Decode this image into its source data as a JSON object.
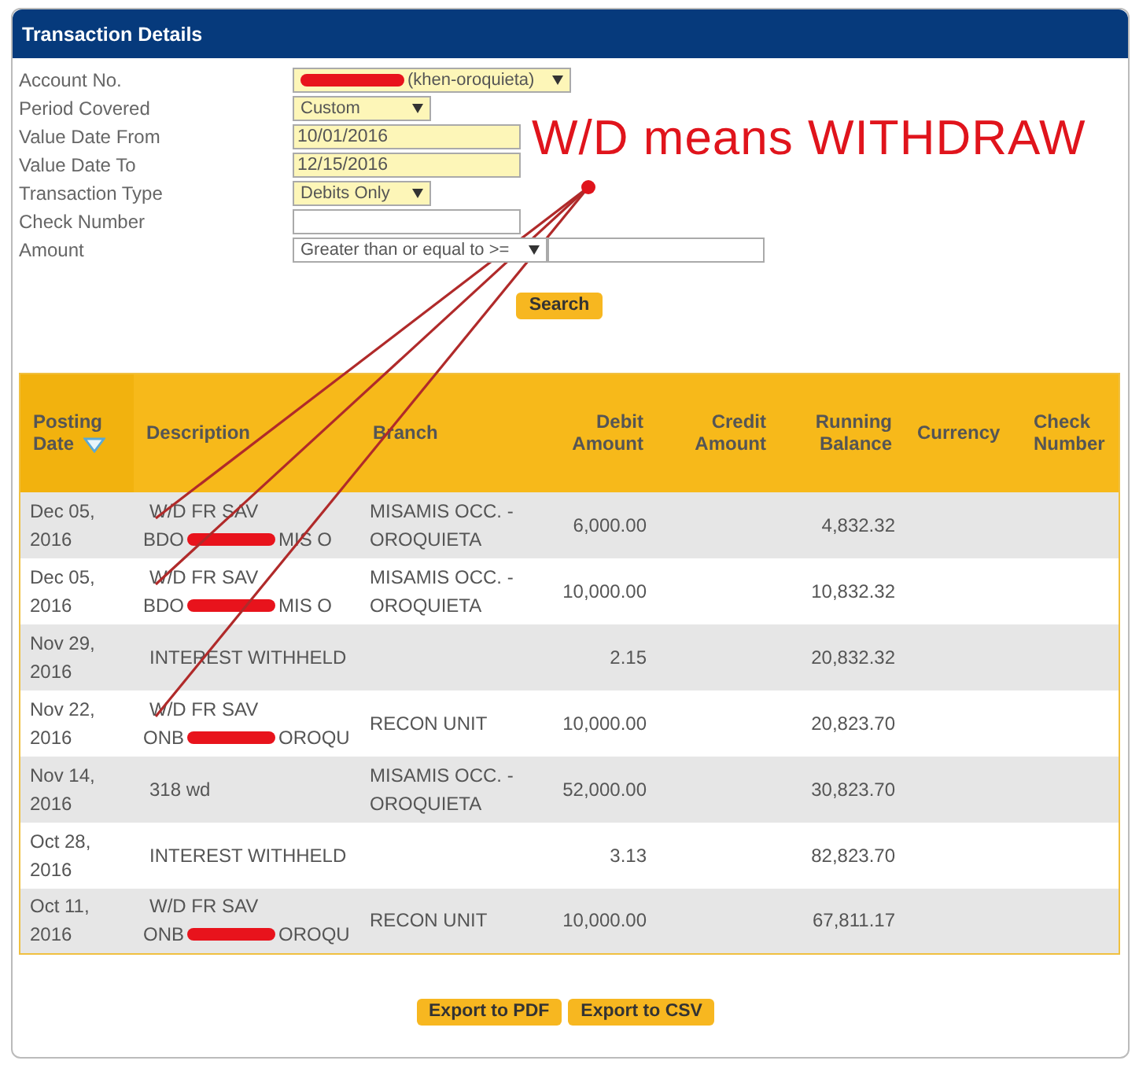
{
  "panel": {
    "title": "Transaction Details"
  },
  "form": [
    {
      "label": "Account No.",
      "kind": "select",
      "value": "(khen-oroquieta)",
      "redacted": true,
      "highlighted": true
    },
    {
      "label": "Period Covered",
      "kind": "select",
      "value": "Custom",
      "redacted": false,
      "highlighted": true
    },
    {
      "label": "Value Date From",
      "kind": "text",
      "value": "10/01/2016",
      "redacted": false,
      "highlighted": true
    },
    {
      "label": "Value Date To",
      "kind": "text",
      "value": "12/15/2016",
      "redacted": false,
      "highlighted": true
    },
    {
      "label": "Transaction Type",
      "kind": "select",
      "value": "Debits Only",
      "redacted": false,
      "highlighted": true
    },
    {
      "label": "Check Number",
      "kind": "text",
      "redacted": false,
      "highlighted": false
    },
    {
      "label": "Amount",
      "kind": "select-input",
      "value": "Greater than or equal to >=",
      "redacted": false,
      "highlighted": false
    }
  ],
  "search_button": "Search",
  "annotation": {
    "text": "W/D means WITHDRAW"
  },
  "table": {
    "columns": [
      {
        "label": "Posting Date",
        "sorted": true
      },
      {
        "label": "Description",
        "sorted": false
      },
      {
        "label": "Branch",
        "sorted": false
      },
      {
        "label": "Debit Amount",
        "sorted": false
      },
      {
        "label": "Credit Amount",
        "sorted": false
      },
      {
        "label": "Running Balance",
        "sorted": false
      },
      {
        "label": "Currency",
        "sorted": false
      },
      {
        "label": "Check Number",
        "sorted": false
      }
    ],
    "rows": [
      {
        "date": "Dec 05, 2016",
        "description": "W/D FR SAV",
        "description_redacted": {
          "before": "BDO",
          "after": "MIS O"
        },
        "branch": "MISAMIS OCC. - OROQUIETA",
        "debit": "6,000.00",
        "balance": "4,832.32"
      },
      {
        "date": "Dec 05, 2016",
        "description": "W/D FR SAV",
        "description_redacted": {
          "before": "BDO",
          "after": "MIS O"
        },
        "branch": "MISAMIS OCC. - OROQUIETA",
        "debit": "10,000.00",
        "balance": "10,832.32"
      },
      {
        "date": "Nov 29, 2016",
        "description": "INTEREST WITHHELD",
        "debit": "2.15",
        "balance": "20,832.32"
      },
      {
        "date": "Nov 22, 2016",
        "description": "W/D FR SAV",
        "description_redacted": {
          "before": "ONB",
          "after": "OROQU"
        },
        "branch": "RECON UNIT",
        "debit": "10,000.00",
        "balance": "20,823.70"
      },
      {
        "date": "Nov 14, 2016",
        "description": "318 wd",
        "branch": "MISAMIS OCC. - OROQUIETA",
        "debit": "52,000.00",
        "balance": "30,823.70"
      },
      {
        "date": "Oct 28, 2016",
        "description": "INTEREST WITHHELD",
        "debit": "3.13",
        "balance": "82,823.70"
      },
      {
        "date": "Oct 11, 2016",
        "description": "W/D FR SAV",
        "description_redacted": {
          "before": "ONB",
          "after": "OROQU"
        },
        "branch": "RECON UNIT",
        "debit": "10,000.00",
        "balance": "67,811.17"
      }
    ]
  },
  "export_buttons": [
    "Export to PDF",
    "Export to CSV"
  ]
}
